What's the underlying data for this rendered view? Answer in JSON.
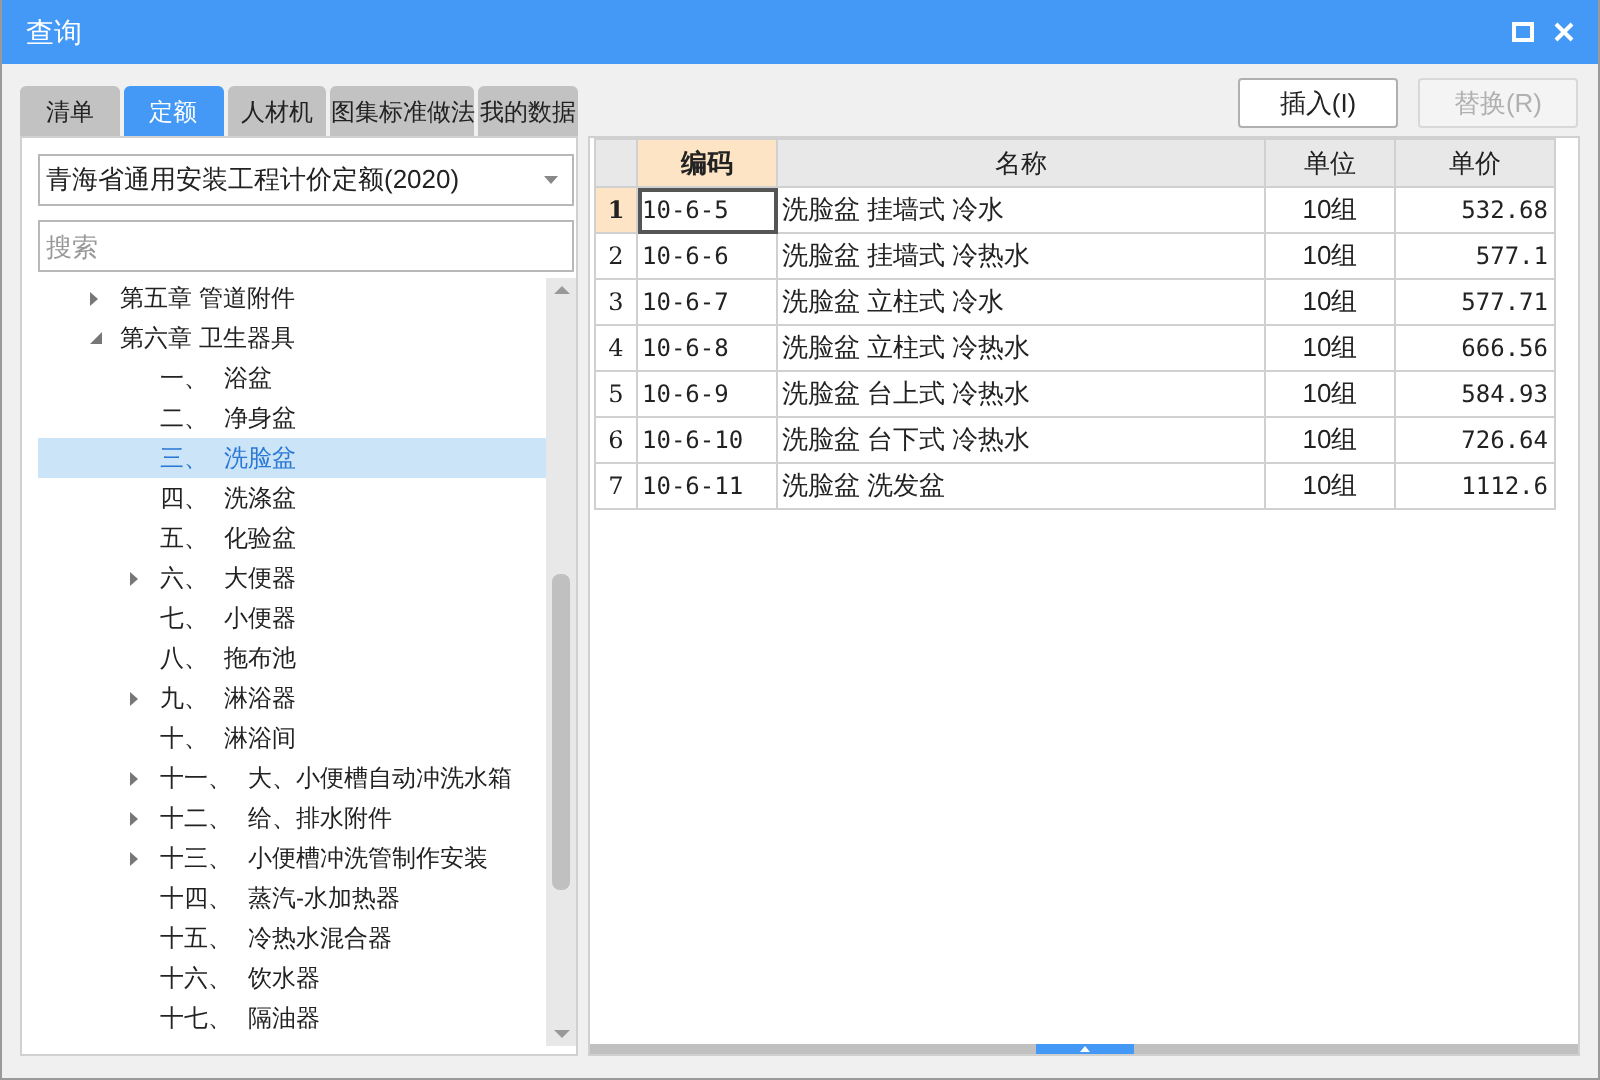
{
  "window": {
    "title": "查询"
  },
  "tabs": [
    {
      "label": "清单",
      "selected": false
    },
    {
      "label": "定额",
      "selected": true
    },
    {
      "label": "人材机",
      "selected": false
    },
    {
      "label": "图集标准做法",
      "selected": false
    },
    {
      "label": "我的数据",
      "selected": false
    }
  ],
  "library_dropdown": {
    "value": "青海省通用安装工程计价定额(2020)"
  },
  "search": {
    "placeholder": "搜索"
  },
  "tree": [
    {
      "label": "第五章 管道附件",
      "kind": "branch",
      "expanded": false,
      "selected": false
    },
    {
      "label": "第六章 卫生器具",
      "kind": "branch",
      "expanded": true,
      "selected": false,
      "children": [
        {
          "number": "一、",
          "label": "浴盆",
          "kind": "leaf",
          "selected": false
        },
        {
          "number": "二、",
          "label": "净身盆",
          "kind": "leaf",
          "selected": false
        },
        {
          "number": "三、",
          "label": "洗脸盆",
          "kind": "leaf",
          "selected": true
        },
        {
          "number": "四、",
          "label": "洗涤盆",
          "kind": "leaf",
          "selected": false
        },
        {
          "number": "五、",
          "label": "化验盆",
          "kind": "leaf",
          "selected": false
        },
        {
          "number": "六、",
          "label": "大便器",
          "kind": "branch",
          "expanded": false,
          "selected": false
        },
        {
          "number": "七、",
          "label": "小便器",
          "kind": "leaf",
          "selected": false
        },
        {
          "number": "八、",
          "label": "拖布池",
          "kind": "leaf",
          "selected": false
        },
        {
          "number": "九、",
          "label": "淋浴器",
          "kind": "branch",
          "expanded": false,
          "selected": false
        },
        {
          "number": "十、",
          "label": "淋浴间",
          "kind": "leaf",
          "selected": false
        },
        {
          "number": "十一、",
          "label": "大、小便槽自动冲洗水箱",
          "kind": "branch",
          "expanded": false,
          "selected": false
        },
        {
          "number": "十二、",
          "label": "给、排水附件",
          "kind": "branch",
          "expanded": false,
          "selected": false
        },
        {
          "number": "十三、",
          "label": "小便槽冲洗管制作安装",
          "kind": "branch",
          "expanded": false,
          "selected": false
        },
        {
          "number": "十四、",
          "label": "蒸汽-水加热器",
          "kind": "leaf",
          "selected": false
        },
        {
          "number": "十五、",
          "label": "冷热水混合器",
          "kind": "leaf",
          "selected": false
        },
        {
          "number": "十六、",
          "label": "饮水器",
          "kind": "leaf",
          "selected": false
        },
        {
          "number": "十七、",
          "label": "隔油器",
          "kind": "leaf",
          "selected": false
        }
      ]
    }
  ],
  "buttons": [
    {
      "label": "插入(I)",
      "disabled": false
    },
    {
      "label": "替换(R)",
      "disabled": true
    }
  ],
  "table": {
    "columns": [
      {
        "label": "编码",
        "selected": true
      },
      {
        "label": "名称",
        "selected": false
      },
      {
        "label": "单位",
        "selected": false
      },
      {
        "label": "单价",
        "selected": false
      }
    ],
    "rows": [
      {
        "number": "1",
        "code": "10-6-5",
        "name": "洗脸盆 挂墙式 冷水",
        "unit": "10组",
        "price": "532.68",
        "selected": true
      },
      {
        "number": "2",
        "code": "10-6-6",
        "name": "洗脸盆 挂墙式 冷热水",
        "unit": "10组",
        "price": "577.1",
        "selected": false
      },
      {
        "number": "3",
        "code": "10-6-7",
        "name": "洗脸盆 立柱式 冷水",
        "unit": "10组",
        "price": "577.71",
        "selected": false
      },
      {
        "number": "4",
        "code": "10-6-8",
        "name": "洗脸盆 立柱式 冷热水",
        "unit": "10组",
        "price": "666.56",
        "selected": false
      },
      {
        "number": "5",
        "code": "10-6-9",
        "name": "洗脸盆 台上式 冷热水",
        "unit": "10组",
        "price": "584.93",
        "selected": false
      },
      {
        "number": "6",
        "code": "10-6-10",
        "name": "洗脸盆 台下式 冷热水",
        "unit": "10组",
        "price": "726.64",
        "selected": false
      },
      {
        "number": "7",
        "code": "10-6-11",
        "name": "洗脸盆 洗发盆",
        "unit": "10组",
        "price": "1112.6",
        "selected": false
      }
    ]
  }
}
